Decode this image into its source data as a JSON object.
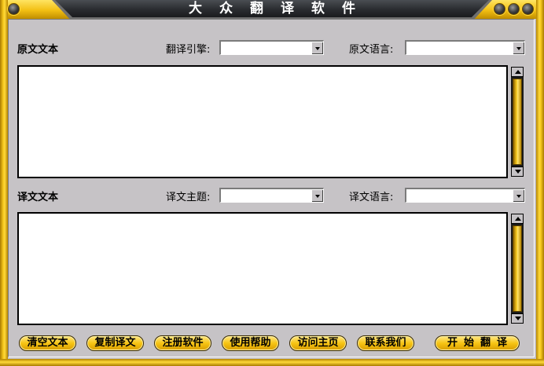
{
  "window": {
    "title": "大众翻译软件",
    "accent": "#f6c81c",
    "frame_dark": "#2a2c30"
  },
  "source_section": {
    "heading": "原文文本",
    "engine_label": "翻译引擎:",
    "engine_value": "",
    "lang_label": "原文语言:",
    "lang_value": "",
    "text": ""
  },
  "target_section": {
    "heading": "译文文本",
    "topic_label": "译文主题:",
    "topic_value": "",
    "lang_label": "译文语言:",
    "lang_value": "",
    "text": ""
  },
  "buttons": {
    "clear": "清空文本",
    "copy": "复制译文",
    "register": "注册软件",
    "help": "使用帮助",
    "homepage": "访问主页",
    "contact": "联系我们",
    "translate": "开始翻译"
  },
  "icons": {
    "left_control": "window-menu-icon",
    "minimize": "minimize-icon",
    "maximize": "maximize-icon",
    "close": "close-icon"
  }
}
